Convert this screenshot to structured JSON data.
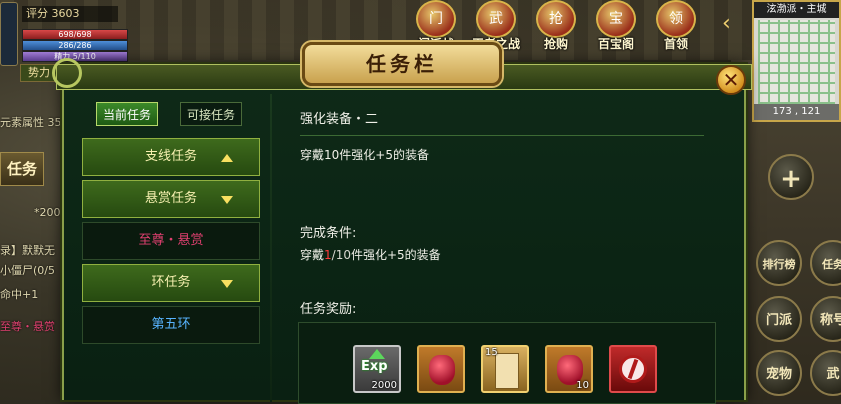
{
  "hud": {
    "rating": "评分 3603",
    "hp": "698/698",
    "mp": "286/286",
    "xp": "精力 5/110",
    "power_tag": "势力",
    "attribute_label": "元素属性",
    "attribute_value": "35",
    "left_tab": "任务",
    "exp_count": "*200",
    "side_lines": [
      "录】默默无",
      "小僵尸(0/5",
      "命中+1",
      "至尊・悬赏"
    ]
  },
  "top_menu": {
    "items": [
      {
        "label": "门派战",
        "icon": "门"
      },
      {
        "label": "王者之战",
        "icon": "武"
      },
      {
        "label": "抢购",
        "icon": "抢"
      },
      {
        "label": "百宝阁",
        "icon": "宝"
      },
      {
        "label": "首领",
        "icon": "领"
      }
    ],
    "arrow": "‹"
  },
  "minimap": {
    "location": "泫渤派・主城",
    "coords": "173 , 121"
  },
  "right_buttons": [
    {
      "label": "+"
    },
    {
      "label": "排行榜"
    },
    {
      "label": "任务"
    },
    {
      "label": "门派"
    },
    {
      "label": "称号"
    },
    {
      "label": "宠物"
    },
    {
      "label": "武"
    }
  ],
  "dialog": {
    "title": "任务栏",
    "close": "✕",
    "tabs": {
      "current": "当前任务",
      "available": "可接任务"
    },
    "task_list": [
      {
        "label": "支线任务",
        "kind": "category",
        "arrow": "up"
      },
      {
        "label": "悬赏任务",
        "kind": "category",
        "arrow": "down"
      },
      {
        "label": "至尊・悬赏",
        "kind": "sub",
        "color": "#e04070"
      },
      {
        "label": "环任务",
        "kind": "category",
        "arrow": "down"
      },
      {
        "label": "第五环",
        "kind": "sub",
        "color": "#58b4ff"
      }
    ],
    "detail": {
      "task_name": "强化装备・二",
      "description": "穿戴10件强化+5的装备",
      "condition_title": "完成条件:",
      "condition_prefix": "穿戴",
      "condition_progress": "1",
      "condition_total": "/10",
      "condition_suffix": "件强化+5的装备",
      "reward_title": "任务奖励:",
      "rewards": [
        {
          "name": "exp",
          "icon": "exp-icon",
          "label": "Exp",
          "count": "2000"
        },
        {
          "name": "red-gem",
          "icon": "red-gem-icon",
          "count": ""
        },
        {
          "name": "scroll",
          "icon": "scroll-icon",
          "count_tl": "15"
        },
        {
          "name": "red-gem-stack",
          "icon": "red-gem-icon",
          "count": "10"
        },
        {
          "name": "seal",
          "icon": "seal-icon",
          "count": ""
        }
      ]
    }
  }
}
